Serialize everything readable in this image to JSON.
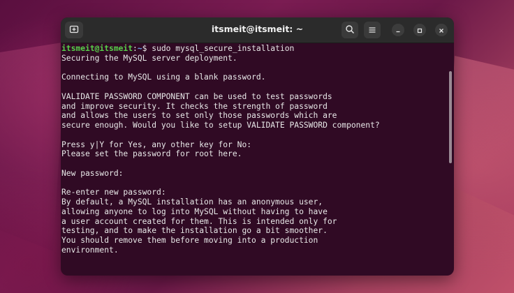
{
  "window": {
    "title": "itsmeit@itsmeit: ~"
  },
  "titlebar": {
    "new_tab_icon": "new-tab-icon",
    "search_icon": "search-icon",
    "menu_icon": "hamburger-menu-icon",
    "minimize_icon": "minimize-icon",
    "maximize_icon": "maximize-icon",
    "close_icon": "close-icon"
  },
  "terminal": {
    "prompt_user": "itsmeit@itsmeit",
    "prompt_sep": ":",
    "prompt_path": "~",
    "prompt_symbol": "$ ",
    "command": "sudo mysql_secure_installation",
    "output": "\nSecuring the MySQL server deployment.\n\nConnecting to MySQL using a blank password.\n\nVALIDATE PASSWORD COMPONENT can be used to test passwords\nand improve security. It checks the strength of password\nand allows the users to set only those passwords which are\nsecure enough. Would you like to setup VALIDATE PASSWORD component?\n\nPress y|Y for Yes, any other key for No:\nPlease set the password for root here.\n\nNew password:\n\nRe-enter new password:\nBy default, a MySQL installation has an anonymous user,\nallowing anyone to log into MySQL without having to have\na user account created for them. This is intended only for\ntesting, and to make the installation go a bit smoother.\nYou should remove them before moving into a production\nenvironment."
  },
  "colors": {
    "terminal_bg": "#300a24",
    "titlebar_bg": "#2b2b2b",
    "prompt_user": "#57d04a",
    "prompt_path": "#6a9fe0",
    "text": "#e8e8e8"
  }
}
